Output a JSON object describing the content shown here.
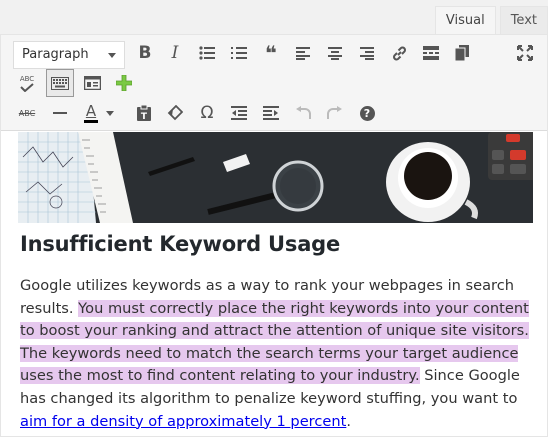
{
  "tabs": {
    "visual": "Visual",
    "text": "Text"
  },
  "toolbar": {
    "format_value": "Paragraph",
    "row1_icons": [
      "bold-icon",
      "italic-icon",
      "bullet-list-icon",
      "numbered-list-icon",
      "blockquote-icon",
      "align-left-icon",
      "align-center-icon",
      "align-right-icon",
      "link-icon",
      "read-more-icon",
      "paste-icon",
      "fullscreen-icon"
    ],
    "row2_icons": [
      "spellcheck-icon",
      "toolbar-toggle-icon",
      "form-icon",
      "add-plus-icon"
    ],
    "row3_icons": [
      "strikethrough-icon",
      "horizontal-line-icon",
      "text-color-icon",
      "paste-text-icon",
      "clear-formatting-icon",
      "special-character-icon",
      "outdent-icon",
      "indent-icon",
      "undo-icon",
      "redo-icon",
      "help-icon"
    ],
    "bold": "B",
    "italic": "I",
    "quote": "❝",
    "omega": "Ω",
    "abc": "ABC",
    "text_color": "A",
    "help": "?"
  },
  "content": {
    "heading": "Insufficient Keyword Usage",
    "para_start": "Google utilizes keywords as a way to rank your webpages in search results. ",
    "para_highlight": "You must correctly place the right keywords into your content to boost your ranking and attract the attention of unique site visitors. The keywords need to match the search terms your target audience uses the most to find content relating to your industry.",
    "para_middle": " Since Google has changed its algorithm to penalize keyword stuffing, you want to ",
    "link_text": "aim for a density of approximately 1 percent",
    "para_end": "."
  },
  "colors": {
    "highlight": "#e6c8ee",
    "link": "#0000ee",
    "toolbar_bg": "#f5f5f5",
    "add_plus": "#7ac943"
  }
}
